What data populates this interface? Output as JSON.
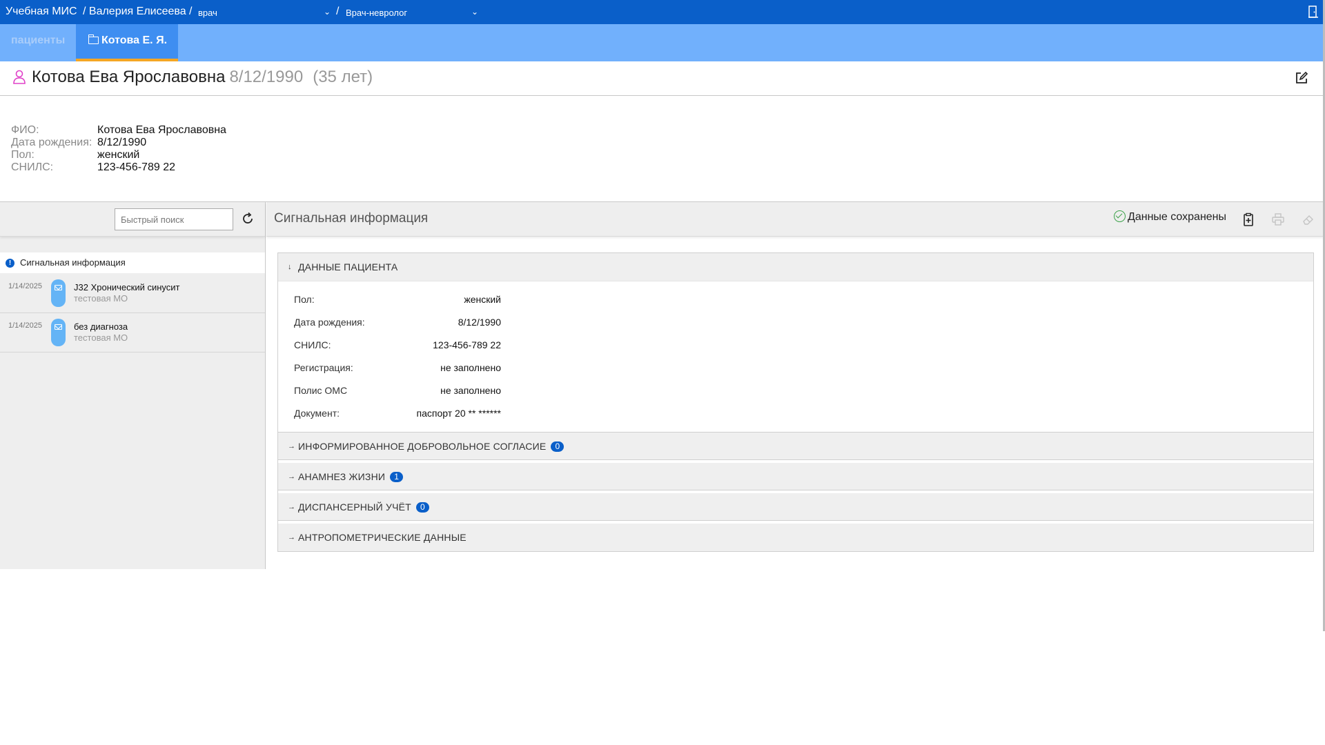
{
  "topbar": {
    "app": "Учебная МИС",
    "user": "/ Валерия Елисеева /",
    "role": "врач",
    "sep": "/",
    "specialty": "Врач-невролог",
    "role_chevron": "⌄",
    "specialty_chevron": "⌄"
  },
  "tabs": {
    "patients": "пациенты",
    "patient": "Котова Е. Я."
  },
  "patient_header": {
    "name": "Котова Ева Ярославовна",
    "dob": "8/12/1990",
    "age": "(35 лет)"
  },
  "info": [
    {
      "label": "ФИО:",
      "value": "Котова Ева Ярославовна"
    },
    {
      "label": "Дата рождения:",
      "value": "8/12/1990"
    },
    {
      "label": "Пол:",
      "value": "женский"
    },
    {
      "label": "СНИЛС:",
      "value": "123-456-789 22"
    }
  ],
  "left": {
    "search_placeholder": "Быстрый поиск",
    "signal_label": "Сигнальная информация",
    "signal_dot": "!",
    "visits": [
      {
        "date": "1/14/2025",
        "title": "J32 Хронический синусит",
        "org": "тестовая МО"
      },
      {
        "date": "1/14/2025",
        "title": "без диагноза",
        "org": "тестовая МО"
      }
    ]
  },
  "right": {
    "title": "Сигнальная информация",
    "saved_status": "Данные сохранены",
    "sections": [
      {
        "title": "ДАННЫЕ ПАЦИЕНТА",
        "arrow": "↓"
      },
      {
        "title": "ИНФОРМИРОВАННОЕ ДОБРОВОЛЬНОЕ СОГЛАСИЕ",
        "arrow": "→",
        "badge": "0"
      },
      {
        "title": "АНАМНЕЗ ЖИЗНИ",
        "arrow": "→",
        "badge": "1"
      },
      {
        "title": "ДИСПАНСЕРНЫЙ УЧЁТ",
        "arrow": "→",
        "badge": "0"
      },
      {
        "title": "АНТРОПОМЕТРИЧЕСКИЕ ДАННЫЕ",
        "arrow": "→"
      }
    ],
    "patient_data": [
      {
        "k": "Пол:",
        "v": "женский"
      },
      {
        "k": "Дата рождения:",
        "v": "8/12/1990"
      },
      {
        "k": "СНИЛС:",
        "v": "123-456-789 22"
      },
      {
        "k": "Регистрация:",
        "v": "не заполнено"
      },
      {
        "k": "Полис ОМС",
        "v": "не заполнено"
      },
      {
        "k": "Документ:",
        "v": "паспорт 20 ** ******"
      }
    ]
  },
  "colors": {
    "topbar": "#0a5fc9",
    "tabbar": "#71b0fc",
    "active_tab": "#3e8ef1",
    "tab_underline": "#f5a623",
    "badge": "#0a5fc9",
    "saved_check": "#3ca24a",
    "person_icon": "#e040c8"
  },
  "icons": [
    "exit-door-icon",
    "folder-icon",
    "person-icon",
    "edit-icon",
    "refresh-icon",
    "info-icon",
    "envelope-icon",
    "check-circle-icon",
    "clipboard-add-icon",
    "print-icon",
    "eraser-icon"
  ]
}
